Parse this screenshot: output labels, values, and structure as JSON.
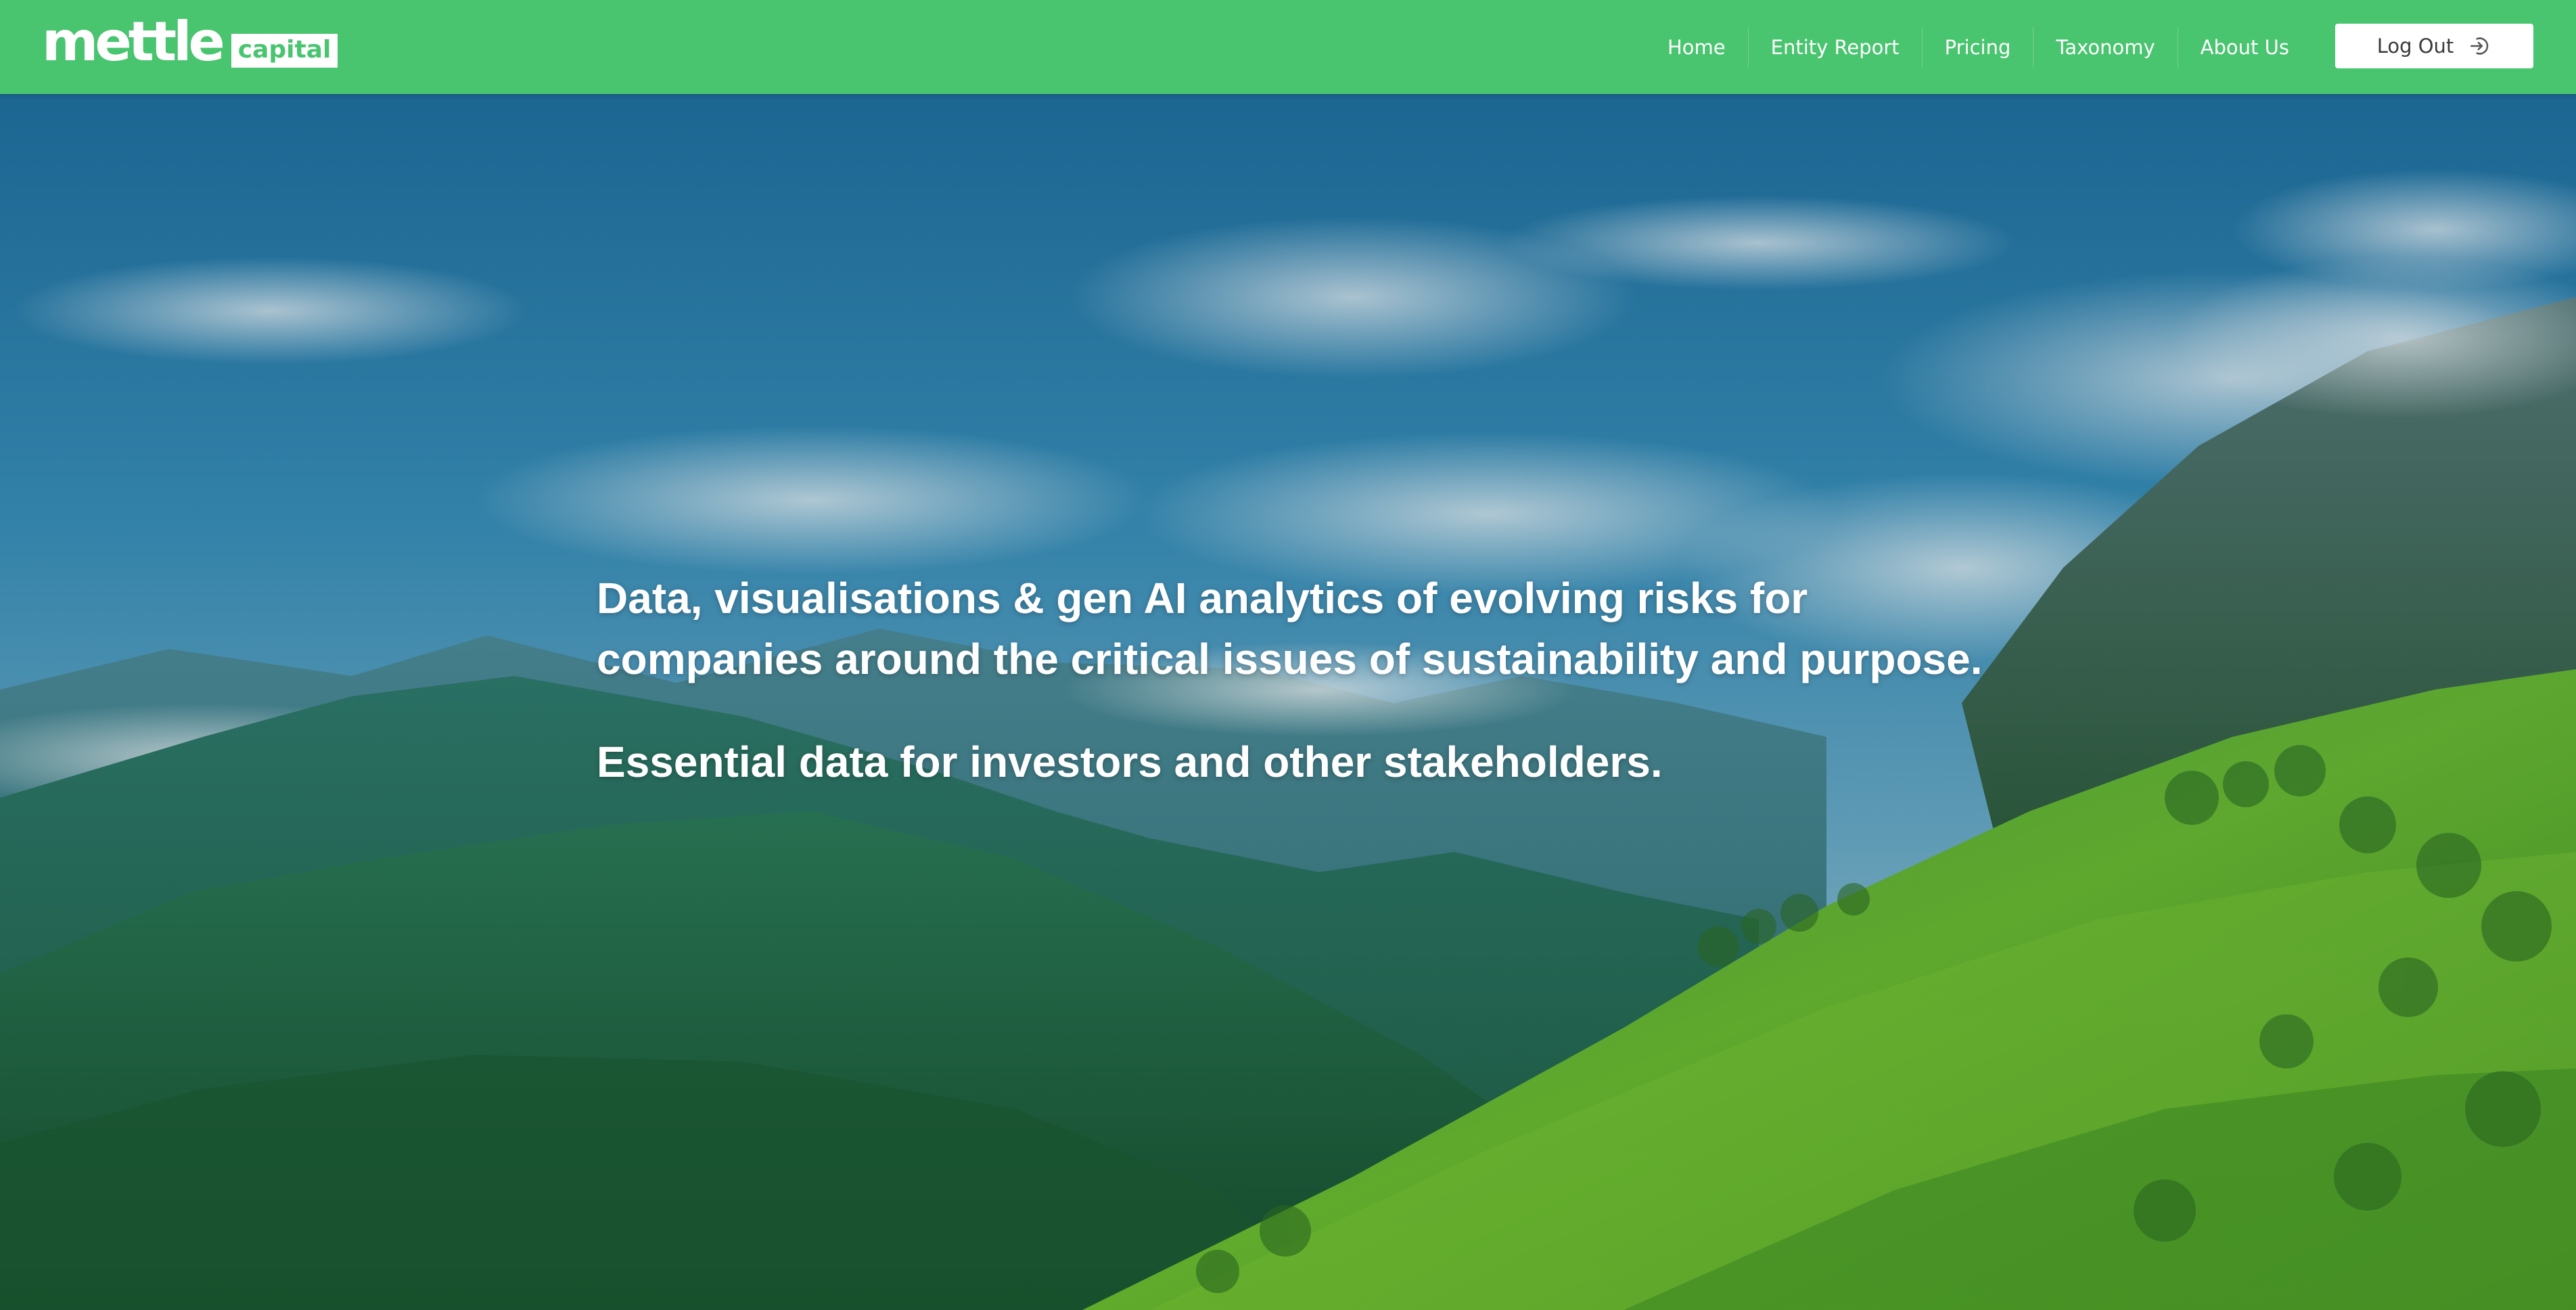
{
  "brand": {
    "name": "mettle",
    "badge": "capital",
    "primary_color": "#49c46f"
  },
  "nav": {
    "items": [
      {
        "label": "Home"
      },
      {
        "label": "Entity Report"
      },
      {
        "label": "Pricing"
      },
      {
        "label": "Taxonomy"
      },
      {
        "label": "About Us"
      }
    ],
    "logout": {
      "label": "Log Out",
      "icon": "logout-icon"
    }
  },
  "hero": {
    "background": "mountain-forest-landscape",
    "headline": "Data, visualisations & gen AI analytics of evolving risks for companies around the critical issues of sustainability and purpose.",
    "subheadline": "Essential data for investors and other stakeholders."
  }
}
